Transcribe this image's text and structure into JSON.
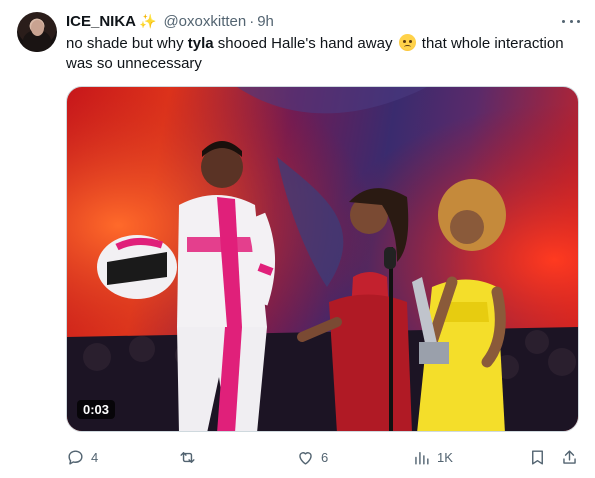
{
  "author": {
    "display_name": "ICE_NIKA",
    "badge_icon": "sparkles-icon",
    "handle": "@oxoxkitten",
    "separator": "·",
    "time": "9h"
  },
  "text": {
    "part1": "no shade but why ",
    "bold": "tyla",
    "part2": " shooed Halle's hand away ",
    "emoji": "pleading-face-emoji",
    "part3": " that whole interaction was so unnecessary"
  },
  "media": {
    "type": "video",
    "duration": "0:03"
  },
  "actions": {
    "reply_count": "4",
    "retweet_count": "",
    "like_count": "6",
    "views_count": "1K"
  },
  "colors": {
    "text_primary": "#0f1419",
    "text_secondary": "#536471",
    "sparkle": "#f5b800"
  }
}
